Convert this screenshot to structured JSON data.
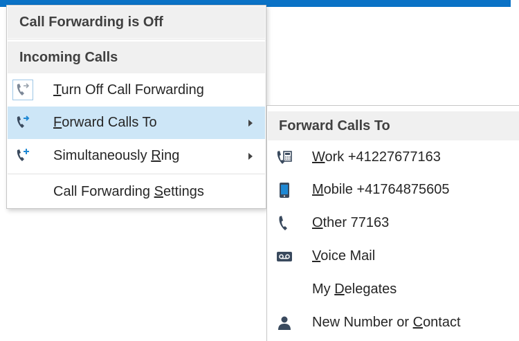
{
  "menu": {
    "status_header": "Call Forwarding is Off",
    "section_header": "Incoming Calls",
    "items": [
      {
        "pre": "",
        "acc": "T",
        "post": "urn Off Call Forwarding",
        "icon": "phone-forward-icon",
        "selected": false,
        "submenu": false
      },
      {
        "pre": "",
        "acc": "F",
        "post": "orward Calls To",
        "icon": "phone-forward-active-icon",
        "selected": true,
        "submenu": true
      },
      {
        "pre": "Simultaneously ",
        "acc": "R",
        "post": "ing",
        "icon": "phone-add-icon",
        "selected": false,
        "submenu": true
      },
      {
        "pre": "Call Forwarding ",
        "acc": "S",
        "post": "ettings",
        "icon": "",
        "selected": false,
        "submenu": false
      }
    ]
  },
  "submenu": {
    "header": "Forward Calls To",
    "items": [
      {
        "pre": "",
        "acc": "W",
        "post": "ork +41227677163",
        "icon": "desk-phone-icon"
      },
      {
        "pre": "",
        "acc": "M",
        "post": "obile +41764875605",
        "icon": "mobile-phone-icon"
      },
      {
        "pre": "",
        "acc": "O",
        "post": "ther 77163",
        "icon": "phone-icon"
      },
      {
        "pre": "",
        "acc": "V",
        "post": "oice Mail",
        "icon": "voicemail-icon"
      },
      {
        "pre": "My ",
        "acc": "D",
        "post": "elegates",
        "icon": ""
      },
      {
        "pre": "New Number or ",
        "acc": "C",
        "post": "ontact",
        "icon": "contact-person-icon"
      }
    ]
  },
  "colors": {
    "title_bar": "#0a72c6",
    "selected_row": "#cde6f7",
    "header_bg": "#f0f0f0",
    "phone_icon": "#3a4a5e",
    "arrow_icon": "#1e88d4"
  }
}
